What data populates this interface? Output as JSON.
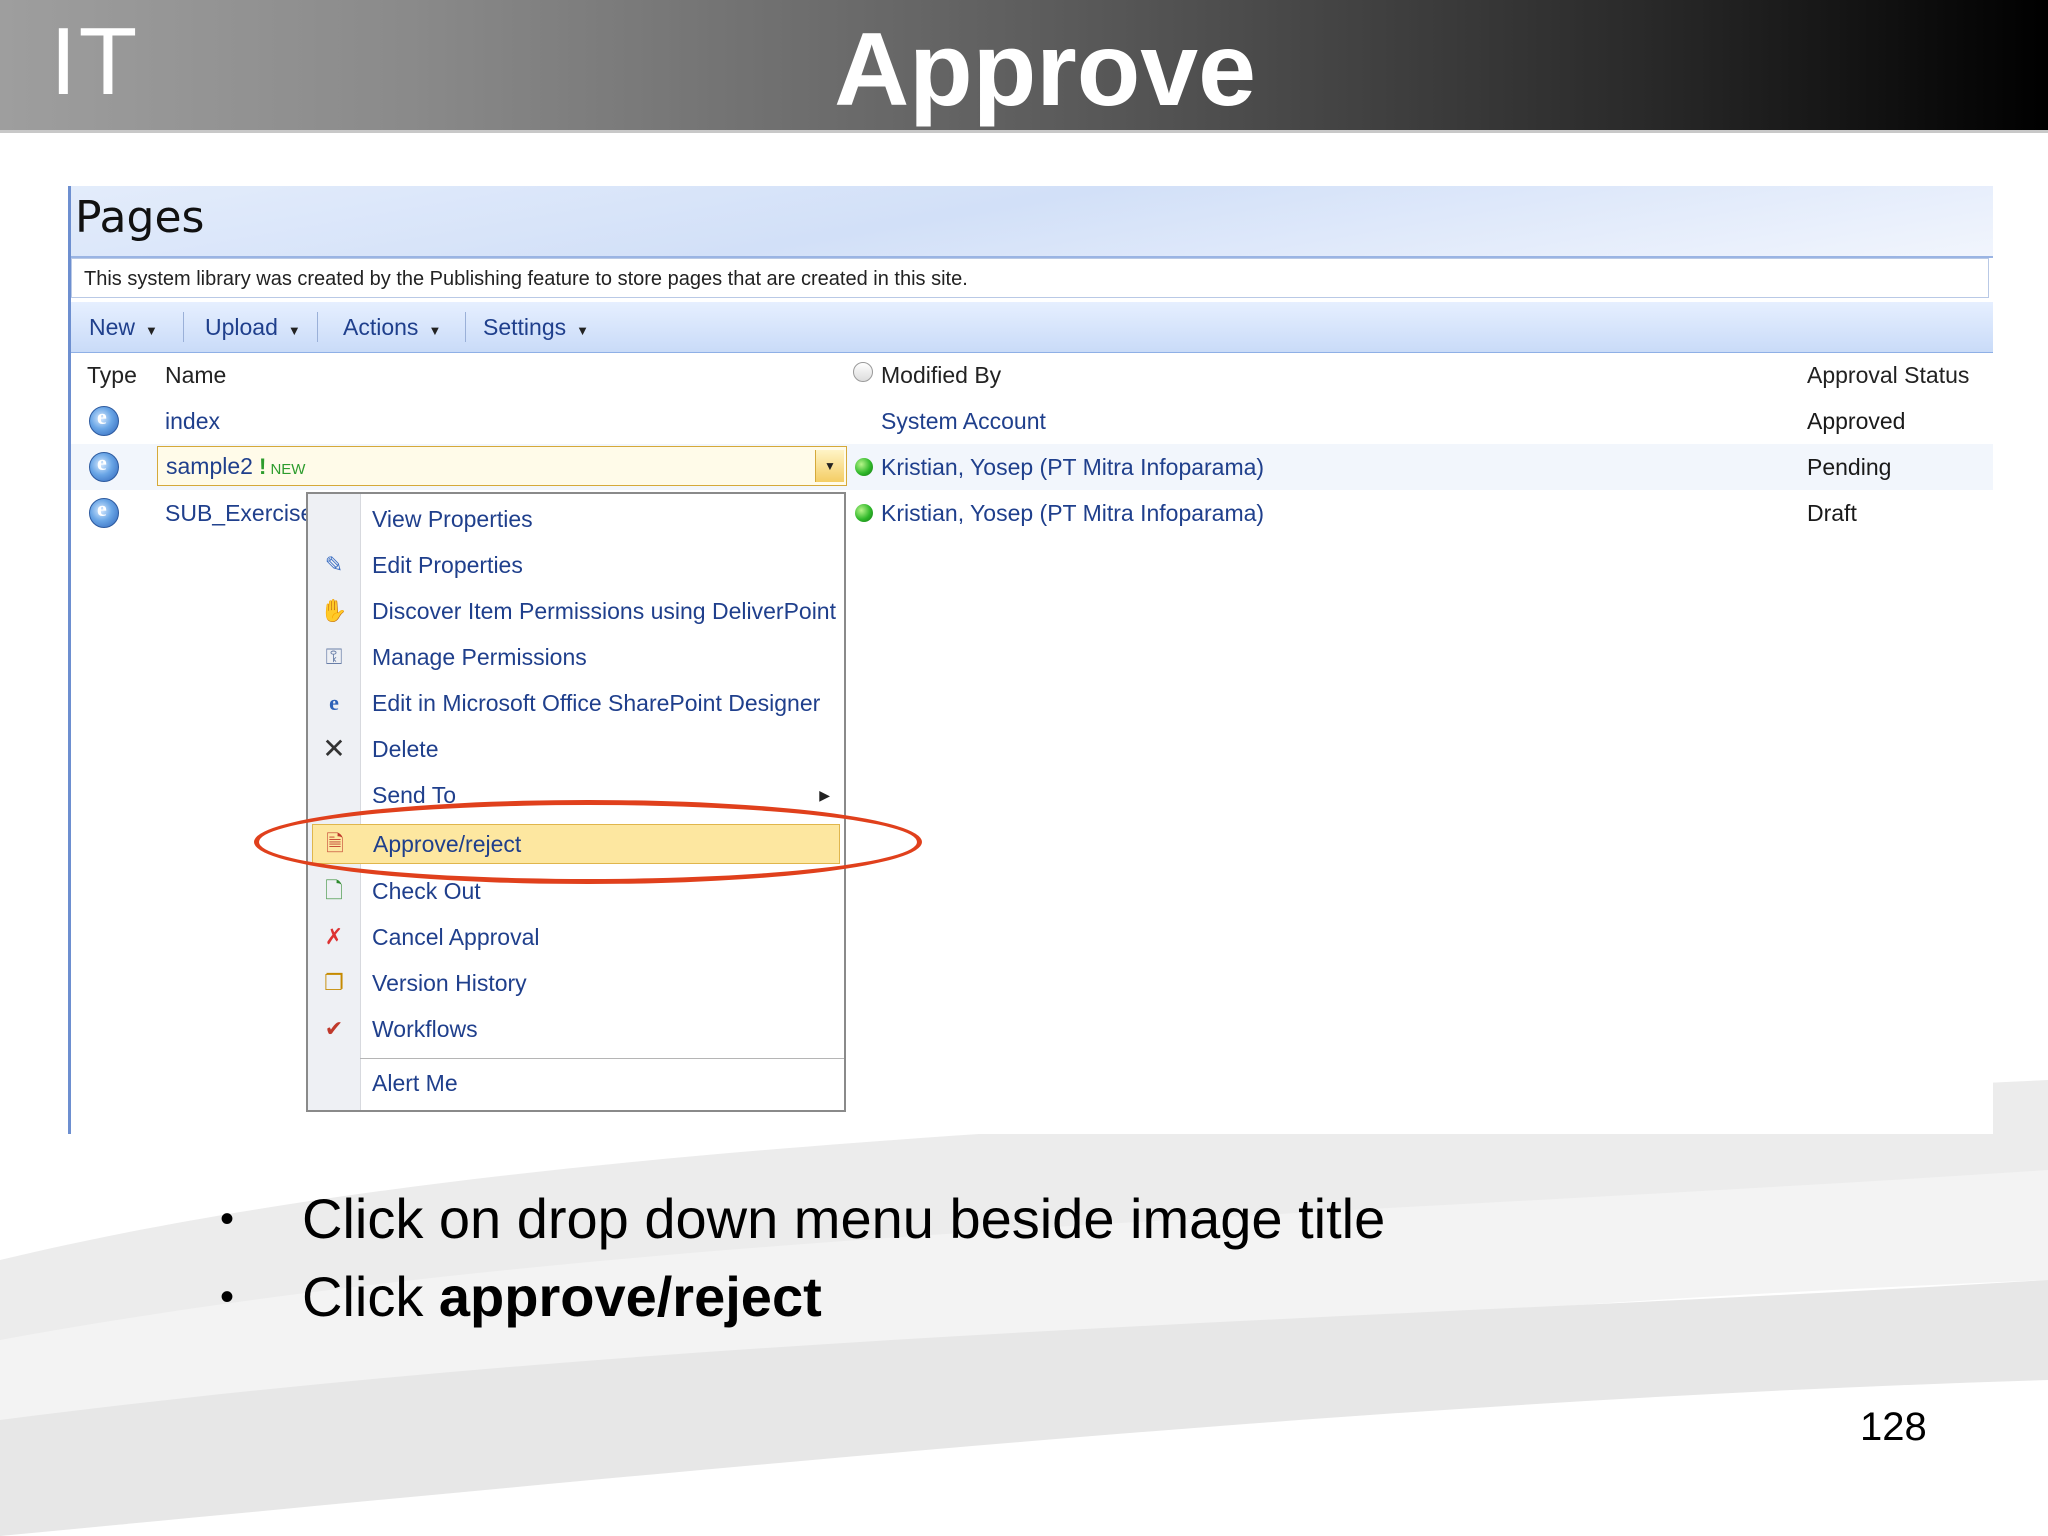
{
  "slide": {
    "logo": "IT",
    "title": "Approve",
    "page_number": "128"
  },
  "library": {
    "title": "Pages",
    "description": "This system library was created by the Publishing feature to store pages that are created in this site.",
    "toolbar": {
      "new": "New",
      "upload": "Upload",
      "actions": "Actions",
      "settings": "Settings"
    },
    "columns": {
      "type": "Type",
      "name": "Name",
      "modified_by": "Modified By",
      "approval_status": "Approval Status"
    },
    "rows": [
      {
        "name": "index",
        "modified_by": "System Account",
        "status": "Approved"
      },
      {
        "name": "sample2",
        "new_tag": "NEW",
        "modified_by": "Kristian, Yosep (PT Mitra Infoparama)",
        "status": "Pending"
      },
      {
        "name": "SUB_Exercise_",
        "modified_by": "Kristian, Yosep (PT Mitra Infoparama)",
        "status": "Draft"
      }
    ]
  },
  "context_menu": {
    "items": [
      {
        "label": "View Properties",
        "icon": "none"
      },
      {
        "label": "Edit Properties",
        "icon": "edit-properties-icon"
      },
      {
        "label": "Discover Item Permissions using DeliverPoint",
        "icon": "permissions-discover-icon"
      },
      {
        "label": "Manage Permissions",
        "icon": "manage-permissions-icon"
      },
      {
        "label": "Edit in Microsoft Office SharePoint Designer",
        "icon": "sharepoint-designer-icon"
      },
      {
        "label": "Delete",
        "icon": "delete-x-icon"
      },
      {
        "label": "Send To",
        "icon": "none"
      },
      {
        "label": "Approve/reject",
        "icon": "approve-icon"
      },
      {
        "label": "Check Out",
        "icon": "check-out-icon"
      },
      {
        "label": "Cancel Approval",
        "icon": "cancel-approval-icon"
      },
      {
        "label": "Version History",
        "icon": "version-history-icon"
      },
      {
        "label": "Workflows",
        "icon": "workflows-icon"
      },
      {
        "label": "Alert Me",
        "icon": "none"
      }
    ],
    "highlight_color": "#fde7a0"
  },
  "bullets": {
    "b1": "Click on drop down menu beside image title",
    "b2_prefix": "Click ",
    "b2_bold": "approve/reject"
  },
  "colors": {
    "link": "#1f3f8c",
    "annotation": "#e0401c"
  }
}
